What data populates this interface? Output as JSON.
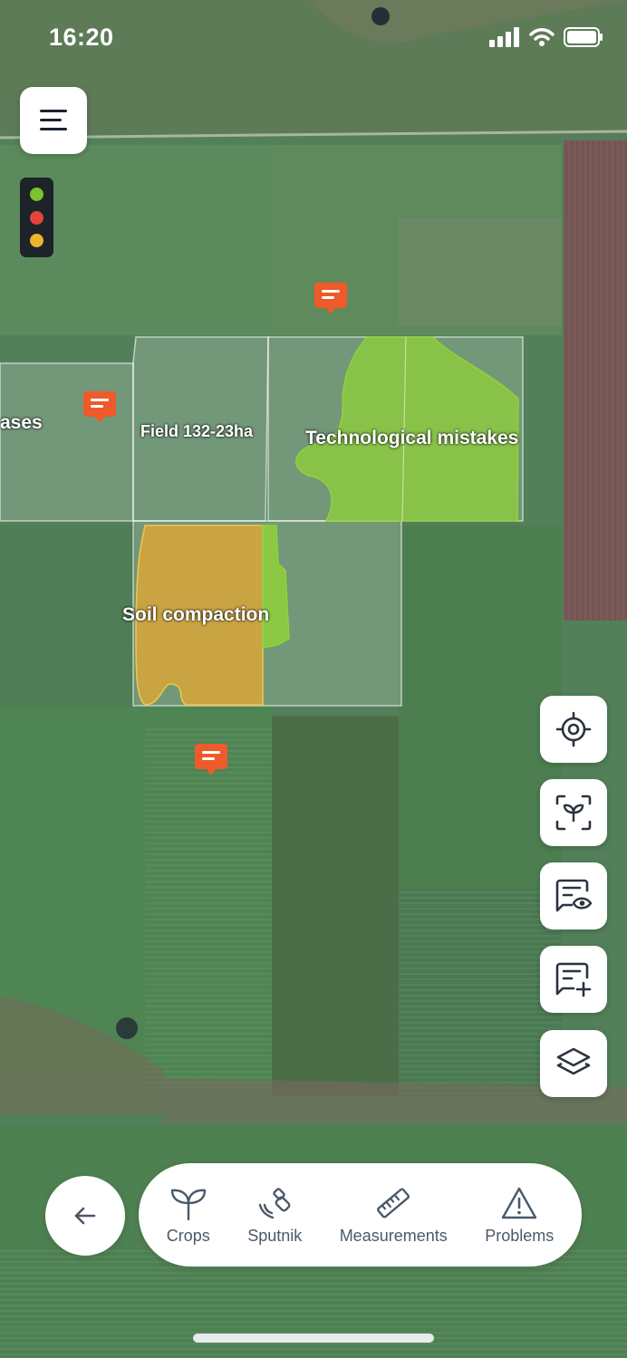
{
  "status_bar": {
    "time": "16:20"
  },
  "map": {
    "fields": [
      {
        "label": "ases"
      },
      {
        "label": "Field 132-23ha"
      },
      {
        "label": "Technological mistakes"
      },
      {
        "label": "Soil compaction"
      }
    ]
  },
  "traffic_light": {
    "colors": [
      "#7bc22b",
      "#e6433a",
      "#efb42a"
    ]
  },
  "colors": {
    "accent_marker": "#ef5a2b",
    "green_zone": "#8fd03a",
    "yellow_zone": "#d9a63a"
  },
  "bottom_nav": {
    "items": [
      {
        "label": "Crops",
        "icon": "sprout-icon"
      },
      {
        "label": "Sputnik",
        "icon": "satellite-icon"
      },
      {
        "label": "Measurements",
        "icon": "ruler-icon"
      },
      {
        "label": "Problems",
        "icon": "warning-icon"
      }
    ]
  }
}
